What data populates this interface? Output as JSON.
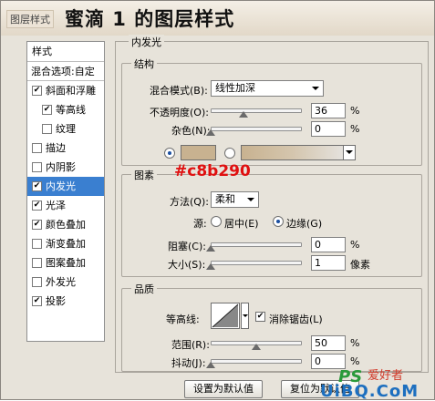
{
  "window": {
    "title_prefix": "图层样式",
    "title_main": "蜜滴 1 的图层样式"
  },
  "sidebar": {
    "header": "样式",
    "blend_options": "混合选项:自定",
    "items": [
      {
        "label": "斜面和浮雕",
        "checked": true,
        "sub": false,
        "selected": false
      },
      {
        "label": "等高线",
        "checked": true,
        "sub": true,
        "selected": false
      },
      {
        "label": "纹理",
        "checked": false,
        "sub": true,
        "selected": false
      },
      {
        "label": "描边",
        "checked": false,
        "sub": false,
        "selected": false
      },
      {
        "label": "内阴影",
        "checked": false,
        "sub": false,
        "selected": false
      },
      {
        "label": "内发光",
        "checked": true,
        "sub": false,
        "selected": true
      },
      {
        "label": "光泽",
        "checked": true,
        "sub": false,
        "selected": false
      },
      {
        "label": "颜色叠加",
        "checked": true,
        "sub": false,
        "selected": false
      },
      {
        "label": "渐变叠加",
        "checked": false,
        "sub": false,
        "selected": false
      },
      {
        "label": "图案叠加",
        "checked": false,
        "sub": false,
        "selected": false
      },
      {
        "label": "外发光",
        "checked": false,
        "sub": false,
        "selected": false
      },
      {
        "label": "投影",
        "checked": true,
        "sub": false,
        "selected": false
      }
    ]
  },
  "panel": {
    "title": "内发光",
    "structure": {
      "title": "结构",
      "blend_mode_label": "混合模式(B):",
      "blend_mode_value": "线性加深",
      "opacity_label": "不透明度(O):",
      "opacity_value": "36",
      "opacity_fraction": 0.36,
      "noise_label": "杂色(N):",
      "noise_value": "0",
      "noise_fraction": 0,
      "percent": "%",
      "glow_color": "#c8b290"
    },
    "color_note": "#c8b290",
    "elements": {
      "title": "图素",
      "method_label": "方法(Q):",
      "method_value": "柔和",
      "source_label": "源:",
      "source_center": "居中(E)",
      "source_edge": "边缘(G)",
      "source_selected": "edge",
      "choke_label": "阻塞(C):",
      "choke_value": "0",
      "choke_fraction": 0,
      "size_label": "大小(S):",
      "size_value": "1",
      "size_fraction": 0.004,
      "size_unit": "像素",
      "percent": "%"
    },
    "quality": {
      "title": "品质",
      "contour_label": "等高线:",
      "antialias_label": "消除锯齿(L)",
      "antialias_checked": true,
      "range_label": "范围(R):",
      "range_value": "50",
      "range_fraction": 0.5,
      "jitter_label": "抖动(J):",
      "jitter_value": "0",
      "jitter_fraction": 0,
      "percent": "%"
    },
    "buttons": {
      "set_default": "设置为默认值",
      "reset_default": "复位为默认值"
    }
  },
  "watermark": {
    "ps": "PS",
    "site_cn": "爱好者",
    "url": "UiBQ.CoM"
  }
}
